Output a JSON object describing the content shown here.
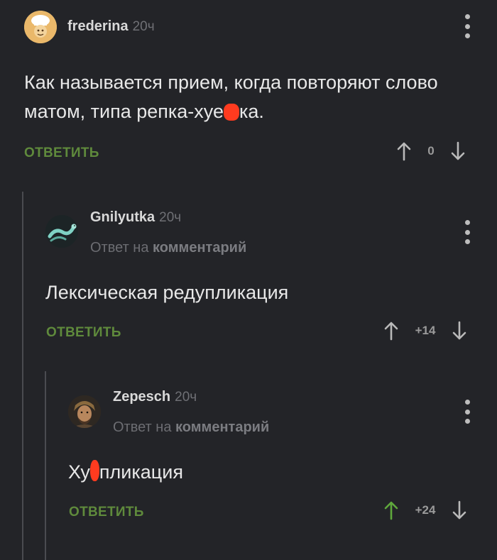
{
  "comments": [
    {
      "author": "frederina",
      "time": "20ч",
      "text_before": "Как называется прием, когда повторяют слово матом, типа репка-хуе",
      "text_after": "ка.",
      "reply_label": "ОТВЕТИТЬ",
      "score": "0",
      "avatar_icon": "chef-avatar-icon"
    },
    {
      "author": "Gnilyutka",
      "time": "20ч",
      "reply_to_prefix": "Ответ на",
      "reply_to_target": "комментарий",
      "text": "Лексическая редупликация",
      "reply_label": "ОТВЕТИТЬ",
      "score": "+14",
      "avatar_icon": "snake-avatar-icon"
    },
    {
      "author": "Zepesch",
      "time": "20ч",
      "reply_to_prefix": "Ответ на",
      "reply_to_target": "комментарий",
      "text_before": "Ху",
      "text_after": "пликация",
      "reply_label": "ОТВЕТИТЬ",
      "score": "+24",
      "avatar_icon": "portrait-avatar-icon"
    }
  ],
  "colors": {
    "background": "#232428",
    "reply_green": "#5f8a3c",
    "upvote_active": "#5fa83c",
    "censor_mark": "#ff3b1f"
  }
}
